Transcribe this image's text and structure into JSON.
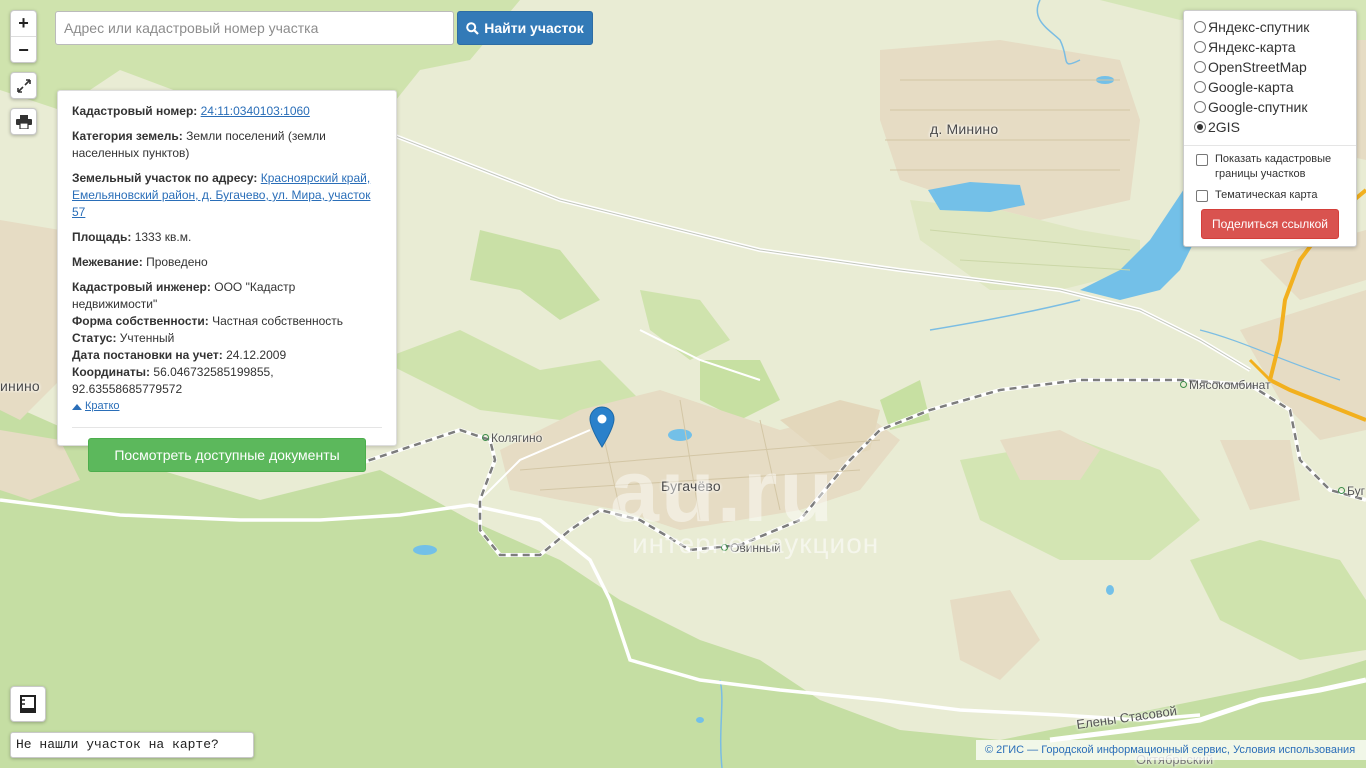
{
  "search": {
    "placeholder": "Адрес или кадастровый номер участка",
    "button_label": "Найти участок"
  },
  "zoom": {
    "in_label": "+",
    "out_label": "−"
  },
  "info": {
    "cadastral_label": "Кадастровый номер:",
    "cadastral_value": "24:11:0340103:1060",
    "category_label": "Категория земель:",
    "category_value": "Земли поселений (земли населенных пунктов)",
    "address_label": "Земельный участок по адресу:",
    "address_value": "Красноярский край, Емельяновский район, д. Бугачево, ул. Мира, участок 57",
    "area_label": "Площадь:",
    "area_value": "1333 кв.м.",
    "survey_label": "Межевание:",
    "survey_value": "Проведено",
    "engineer_label": "Кадастровый инженер:",
    "engineer_value": "ООО \"Кадастр недвижимости\"",
    "ownership_label": "Форма собственности:",
    "ownership_value": "Частная собственность",
    "status_label": "Статус:",
    "status_value": "Учтенный",
    "date_label": "Дата постановки на учет:",
    "date_value": "24.12.2009",
    "coords_label": "Координаты:",
    "coords_value": "56.046732585199855, 92.63558685779572",
    "collapse_label": "Кратко",
    "docs_button": "Посмотреть доступные документы"
  },
  "layers": {
    "options": [
      "Яндекс-спутник",
      "Яндекс-карта",
      "OpenStreetMap",
      "Google-карта",
      "Google-спутник",
      "2GIS"
    ],
    "selected": "2GIS",
    "checkbox_cadastral": "Показать кадастровые границы участков",
    "checkbox_thematic": "Тематическая карта",
    "share_button": "Поделиться ссылкой"
  },
  "map_labels": {
    "minino": "д. Минино",
    "minino_left": "инино",
    "bugachevo": "Бугачёво",
    "kolyagino": "Колягино",
    "ovinny": "Овинный",
    "myasokombinat": "Мясокомбинат",
    "bug_right": "Буг",
    "street_stasovoy": "Елены Стасовой",
    "oktyabrsky": "Октябрьский"
  },
  "watermark": {
    "big": "au.ru",
    "small": "интернет-аукцион"
  },
  "notfound_button": "Не нашли участок на карте?",
  "attribution": {
    "text": "© 2ГИС — Городской информационный сервис,",
    "link": "Условия использования"
  },
  "colors": {
    "forest": "#c9e1a6",
    "field": "#e8ecd2",
    "settlement": "#e6dcc4",
    "water": "#73c0e8",
    "highway": "#f2b01e",
    "accent_blue": "#337ab7",
    "accent_green": "#5cb85c",
    "accent_red": "#d9534f"
  }
}
